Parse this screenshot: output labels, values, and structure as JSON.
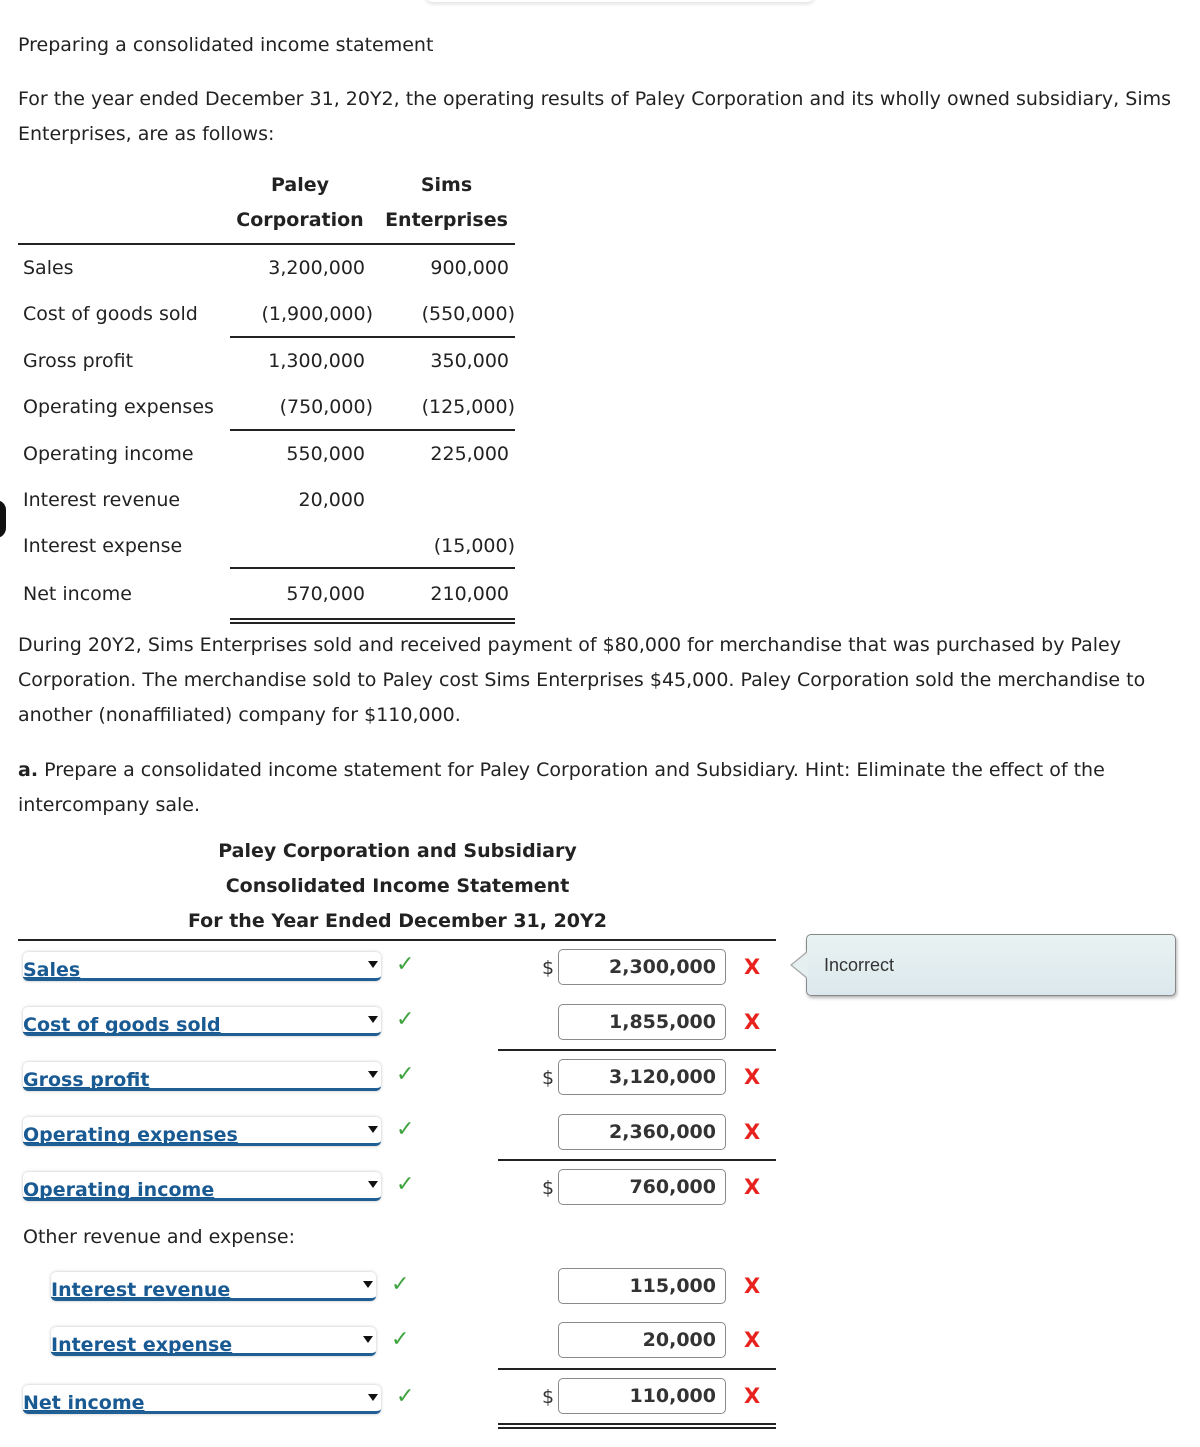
{
  "problem": {
    "title": "Preparing a consolidated income statement",
    "intro": "For the year ended December 31, 20Y2, the operating results of Paley Corporation and its wholly owned subsidiary, Sims Enterprises, are as follows:",
    "during": "During 20Y2, Sims Enterprises sold and received payment of $80,000 for merchandise that was purchased by Paley Corporation. The merchandise sold to Paley cost Sims Enterprises $45,000. Paley Corporation sold the merchandise to another (nonaffiliated) company for $110,000.",
    "part_a_label": "a.",
    "part_a_text": " Prepare a consolidated income statement for Paley Corporation and Subsidiary. Hint: Eliminate the effect of the intercompany sale."
  },
  "source_table": {
    "col1_line1": "Paley",
    "col1_line2": "Corporation",
    "col2_line1": "Sims",
    "col2_line2": "Enterprises",
    "rows": [
      {
        "label": "Sales",
        "paley": "3,200,000",
        "sims": "900,000"
      },
      {
        "label": "Cost of goods sold",
        "paley": "(1,900,000)",
        "sims": "(550,000)"
      },
      {
        "label": "Gross profit",
        "paley": "1,300,000",
        "sims": "350,000"
      },
      {
        "label": "Operating expenses",
        "paley": "(750,000)",
        "sims": "(125,000)"
      },
      {
        "label": "Operating income",
        "paley": "550,000",
        "sims": "225,000"
      },
      {
        "label": "Interest revenue",
        "paley": "20,000",
        "sims": ""
      },
      {
        "label": "Interest expense",
        "paley": "",
        "sims": "(15,000)"
      },
      {
        "label": "Net income",
        "paley": "570,000",
        "sims": "210,000"
      }
    ]
  },
  "statement": {
    "heading1": "Paley Corporation and Subsidiary",
    "heading2": "Consolidated Income Statement",
    "heading3": "For the Year Ended December 31, 20Y2",
    "other_label": "Other revenue and expense:",
    "currency_symbol": "$",
    "check_glyph": "✓",
    "x_glyph": "X",
    "rows": [
      {
        "account": "Sales",
        "amount": "2,300,000",
        "label_status": "correct",
        "amount_status": "incorrect"
      },
      {
        "account": "Cost of goods sold",
        "amount": "1,855,000",
        "label_status": "correct",
        "amount_status": "incorrect"
      },
      {
        "account": "Gross profit",
        "amount": "3,120,000",
        "label_status": "correct",
        "amount_status": "incorrect"
      },
      {
        "account": "Operating expenses",
        "amount": "2,360,000",
        "label_status": "correct",
        "amount_status": "incorrect"
      },
      {
        "account": "Operating income",
        "amount": "760,000",
        "label_status": "correct",
        "amount_status": "incorrect"
      },
      {
        "account": "Interest revenue",
        "amount": "115,000",
        "label_status": "correct",
        "amount_status": "incorrect"
      },
      {
        "account": "Interest expense",
        "amount": "20,000",
        "label_status": "correct",
        "amount_status": "incorrect"
      },
      {
        "account": "Net income",
        "amount": "110,000",
        "label_status": "correct",
        "amount_status": "incorrect"
      }
    ],
    "feedback_tooltip": "Incorrect"
  },
  "colors": {
    "link_blue": "#1a5a93",
    "check_green": "#3fa33f",
    "error_red": "#e8221e"
  }
}
